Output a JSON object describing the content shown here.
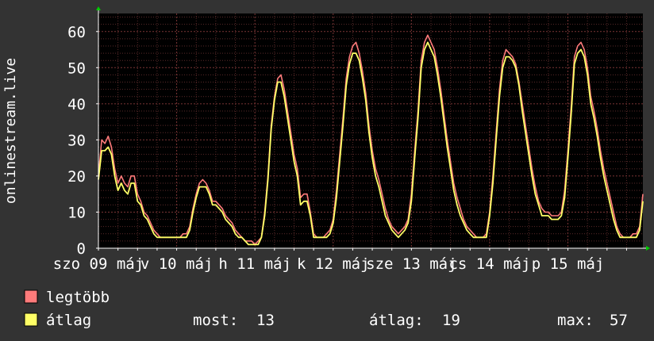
{
  "chart_data": {
    "type": "line",
    "ylabel": "onlinestream.live",
    "ylim": [
      0,
      65
    ],
    "yticks": [
      0,
      10,
      20,
      30,
      40,
      50,
      60
    ],
    "x_tick_labels": [
      "szo 09 máj",
      "v 10 máj",
      "h 11 máj",
      "k 12 máj",
      "sze 13 máj",
      "cs 14 máj",
      "p 15 máj"
    ],
    "grid": true,
    "legend_placement": "bottom-left",
    "sample_interval_hours": 1,
    "series": [
      {
        "name": "legtöbb",
        "color": "#ff7b7b",
        "values": [
          20,
          30,
          29,
          31,
          28,
          22,
          18,
          20,
          18,
          17,
          20,
          20,
          15,
          13,
          10,
          9,
          7,
          5,
          4,
          3,
          3,
          3,
          3,
          3,
          3,
          3,
          4,
          4,
          6,
          11,
          15,
          18,
          19,
          18,
          16,
          13,
          13,
          12,
          11,
          9,
          8,
          7,
          5,
          4,
          3,
          2,
          2,
          2,
          1,
          2,
          3,
          10,
          20,
          34,
          42,
          47,
          48,
          44,
          38,
          32,
          26,
          22,
          14,
          15,
          15,
          10,
          4,
          3,
          3,
          3,
          4,
          5,
          8,
          16,
          26,
          36,
          47,
          53,
          56,
          57,
          54,
          49,
          43,
          34,
          27,
          22,
          19,
          15,
          11,
          8,
          6,
          5,
          4,
          5,
          6,
          8,
          15,
          27,
          38,
          52,
          57,
          59,
          57,
          55,
          50,
          44,
          37,
          30,
          24,
          18,
          14,
          11,
          8,
          6,
          5,
          4,
          3,
          3,
          3,
          4,
          10,
          20,
          32,
          44,
          52,
          55,
          54,
          53,
          51,
          46,
          40,
          34,
          28,
          22,
          17,
          13,
          11,
          10,
          10,
          9,
          9,
          9,
          10,
          16,
          27,
          39,
          53,
          56,
          57,
          55,
          50,
          42,
          38,
          33,
          27,
          22,
          18,
          14,
          10,
          6,
          4,
          3,
          3,
          3,
          4,
          4,
          6,
          15
        ]
      },
      {
        "name": "átlag",
        "color": "#ffff66",
        "values": [
          19,
          27,
          27,
          28,
          26,
          20,
          16,
          18,
          16,
          15,
          18,
          18,
          13,
          12,
          9,
          8,
          6,
          4,
          3,
          3,
          3,
          3,
          3,
          3,
          3,
          3,
          3,
          3,
          5,
          10,
          14,
          17,
          17,
          17,
          15,
          12,
          12,
          11,
          10,
          8,
          7,
          6,
          4,
          3,
          3,
          2,
          1,
          1,
          1,
          1,
          3,
          9,
          19,
          33,
          41,
          46,
          46,
          42,
          36,
          30,
          24,
          20,
          12,
          13,
          13,
          9,
          3,
          3,
          3,
          3,
          3,
          4,
          7,
          14,
          24,
          34,
          45,
          51,
          54,
          54,
          52,
          47,
          41,
          32,
          25,
          20,
          17,
          13,
          9,
          7,
          5,
          4,
          3,
          4,
          5,
          7,
          13,
          25,
          36,
          50,
          55,
          57,
          55,
          53,
          48,
          42,
          35,
          28,
          22,
          16,
          12,
          9,
          7,
          5,
          4,
          3,
          3,
          3,
          3,
          3,
          9,
          18,
          30,
          42,
          50,
          53,
          53,
          52,
          50,
          45,
          38,
          32,
          26,
          20,
          15,
          12,
          9,
          9,
          9,
          8,
          8,
          8,
          9,
          14,
          25,
          37,
          51,
          54,
          55,
          53,
          48,
          40,
          36,
          31,
          25,
          20,
          16,
          12,
          8,
          5,
          3,
          3,
          3,
          3,
          3,
          3,
          5,
          13
        ]
      }
    ]
  },
  "legend": [
    {
      "label": "legtöbb",
      "color": "#ff7b7b"
    },
    {
      "label": "átlag",
      "color": "#ffff66"
    }
  ],
  "stats": {
    "now_label": "most:",
    "now_value": "13",
    "avg_label": "átlag:",
    "avg_value": "19",
    "max_label": "max:",
    "max_value": "57"
  },
  "colors": {
    "background": "#333333",
    "plot_background": "#000000",
    "grid_minor": "#5a2a2a",
    "grid_major": "#7a3535",
    "axis_arrow": "#00cc00"
  }
}
